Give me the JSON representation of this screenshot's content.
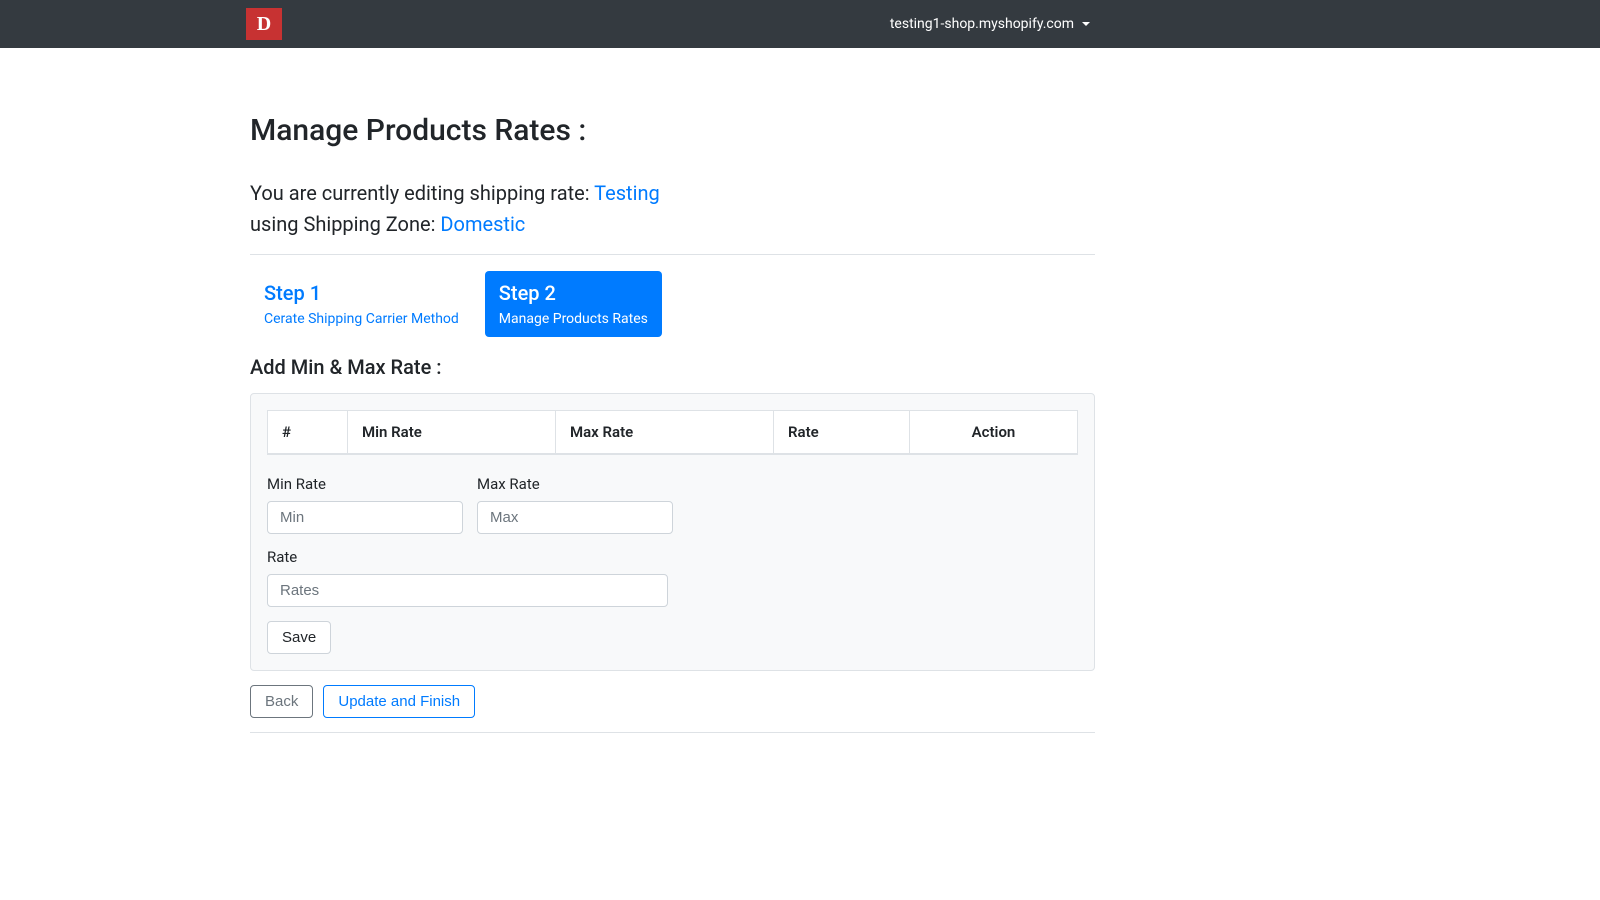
{
  "navbar": {
    "logo_text": "D",
    "shop_domain": "testing1-shop.myshopify.com"
  },
  "page": {
    "title": "Manage Products Rates :",
    "context_prefix": "You are currently editing shipping rate: ",
    "rate_name": "Testing",
    "zone_prefix": "using Shipping Zone: ",
    "zone_name": "Domestic"
  },
  "steps": [
    {
      "title": "Step 1",
      "subtitle": "Cerate Shipping Carrier Method",
      "active": false
    },
    {
      "title": "Step 2",
      "subtitle": "Manage Products Rates",
      "active": true
    }
  ],
  "section": {
    "title": "Add Min & Max Rate :"
  },
  "table": {
    "headers": [
      "#",
      "Min Rate",
      "Max Rate",
      "Rate",
      "Action"
    ]
  },
  "form": {
    "min_label": "Min Rate",
    "min_placeholder": "Min",
    "max_label": "Max Rate",
    "max_placeholder": "Max",
    "rate_label": "Rate",
    "rate_placeholder": "Rates",
    "save_label": "Save"
  },
  "footer": {
    "back_label": "Back",
    "update_label": "Update and Finish"
  }
}
